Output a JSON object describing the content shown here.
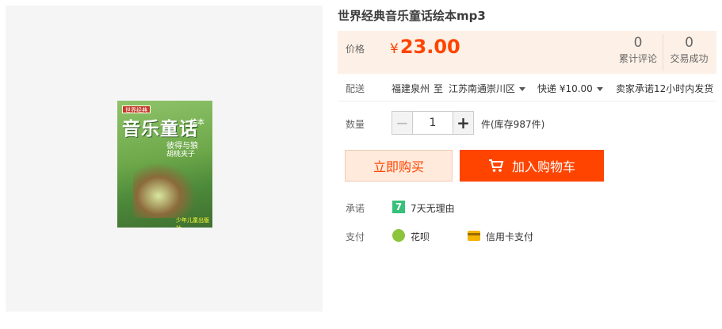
{
  "product": {
    "title": "世界经典音乐童话绘本mp3",
    "cover": {
      "ribbon": "世界经典",
      "title": "音乐童话",
      "suffix": "绘本",
      "sub1": "彼得与狼",
      "sub2": "胡桃夹子",
      "publisher": "少年儿童出版社"
    }
  },
  "price": {
    "label": "价格",
    "currency": "¥",
    "amount": "23.00",
    "stats": [
      {
        "count": "0",
        "label": "累计评论"
      },
      {
        "count": "0",
        "label": "交易成功"
      }
    ]
  },
  "shipping": {
    "label": "配送",
    "from": "福建泉州",
    "to_word": "至",
    "destination": "江苏南通崇川区",
    "method": "快递 ¥10.00",
    "promise": "卖家承诺12小时内发货"
  },
  "quantity": {
    "label": "数量",
    "minus": "−",
    "value": "1",
    "plus": "+",
    "stock": "件(库存987件)"
  },
  "actions": {
    "buy_now": "立即购买",
    "add_to_cart": "加入购物车"
  },
  "promise": {
    "label": "承诺",
    "badge": "7",
    "text": "7天无理由"
  },
  "payment": {
    "label": "支付",
    "methods": [
      "花呗",
      "信用卡支付"
    ]
  },
  "colors": {
    "accent": "#ff4400",
    "price_bg": "#fdf0e6",
    "buy_bg": "#ffeadb",
    "badge_green": "#36c07a"
  }
}
